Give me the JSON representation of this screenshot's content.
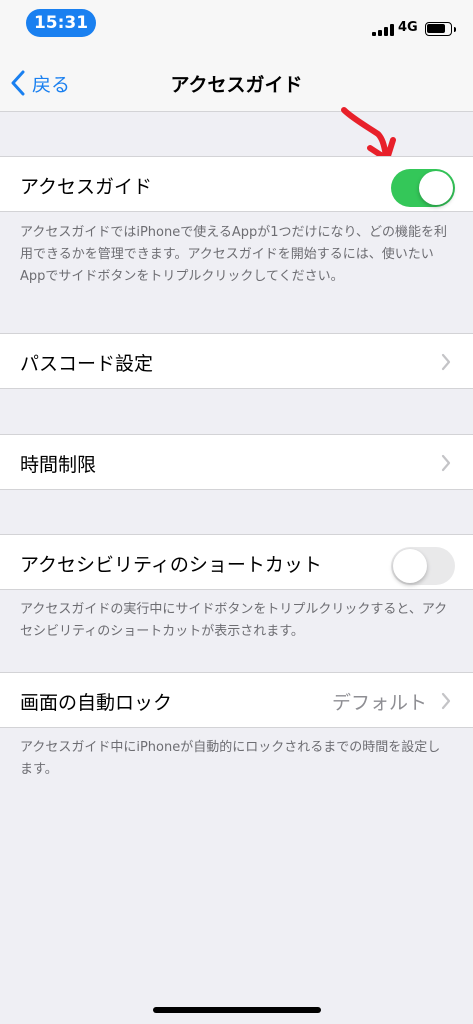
{
  "status_bar": {
    "time": "15:31",
    "network": "4G"
  },
  "nav": {
    "back_label": "戻る",
    "title": "アクセスガイド"
  },
  "sections": {
    "guided_access": {
      "label": "アクセスガイド",
      "toggle": "on",
      "footer": "アクセスガイドではiPhoneで使えるAppが1つだけになり、どの機能を利用できるかを管理できます。アクセスガイドを開始するには、使いたいAppでサイドボタンをトリプルクリックしてください。"
    },
    "passcode": {
      "label": "パスコード設定"
    },
    "time_limits": {
      "label": "時間制限"
    },
    "accessibility_shortcut": {
      "label": "アクセシビリティのショートカット",
      "toggle": "off",
      "footer": "アクセスガイドの実行中にサイドボタンをトリプルクリックすると、アクセシビリティのショートカットが表示されます。"
    },
    "auto_lock": {
      "label": "画面の自動ロック",
      "value": "デフォルト",
      "footer": "アクセスガイド中にiPhoneが自動的にロックされるまでの時間を設定します。"
    }
  },
  "colors": {
    "accent": "#1a80f0",
    "toggle_on": "#34c759",
    "annotation": "#e8202a"
  }
}
